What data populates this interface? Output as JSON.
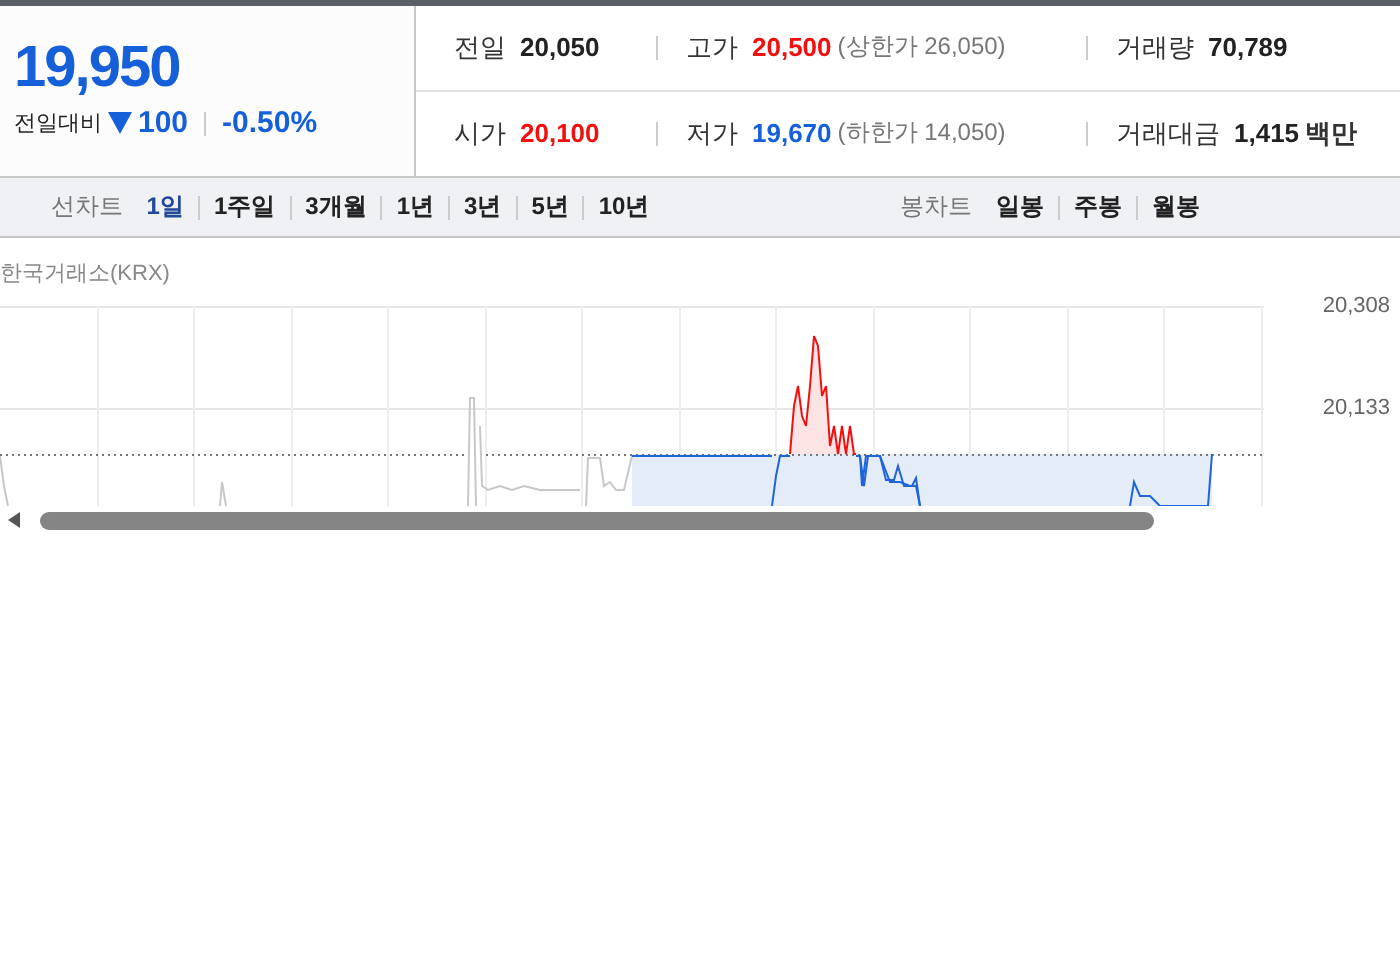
{
  "quote": {
    "price": "19,950",
    "change_label": "전일대비",
    "falling": true,
    "change": "100",
    "change_rate": "-0.50%"
  },
  "stats": [
    {
      "label": "전일",
      "value": "20,050",
      "color": "#222222"
    },
    {
      "label": "고가",
      "value": "20,500",
      "color": "#f01010",
      "note": "(상한가 26,050)"
    },
    {
      "label": "거래량",
      "value": "70,789",
      "color": "#222222"
    },
    {
      "label": "시가",
      "value": "20,100",
      "color": "#f01010"
    },
    {
      "label": "저가",
      "value": "19,670",
      "color": "#1560d8",
      "note": "(하한가 14,050)"
    },
    {
      "label": "거래대금",
      "value": "1,415",
      "color": "#222222",
      "unit": "백만"
    }
  ],
  "toolbar": {
    "groups": [
      {
        "label": "선차트",
        "periods": [
          {
            "label": "1일",
            "selected": true
          },
          {
            "label": "1주일",
            "selected": false
          },
          {
            "label": "3개월",
            "selected": false
          },
          {
            "label": "1년",
            "selected": false
          },
          {
            "label": "3년",
            "selected": false
          },
          {
            "label": "5년",
            "selected": false
          },
          {
            "label": "10년",
            "selected": false
          }
        ]
      },
      {
        "label": "봉차트",
        "periods": [
          {
            "label": "일봉",
            "selected": false
          },
          {
            "label": "주봉",
            "selected": false
          },
          {
            "label": "월봉",
            "selected": false
          }
        ]
      }
    ]
  },
  "chart": {
    "source": "한국거래소(KRX)",
    "y_labels": [
      "20,308",
      "20,133"
    ]
  }
}
